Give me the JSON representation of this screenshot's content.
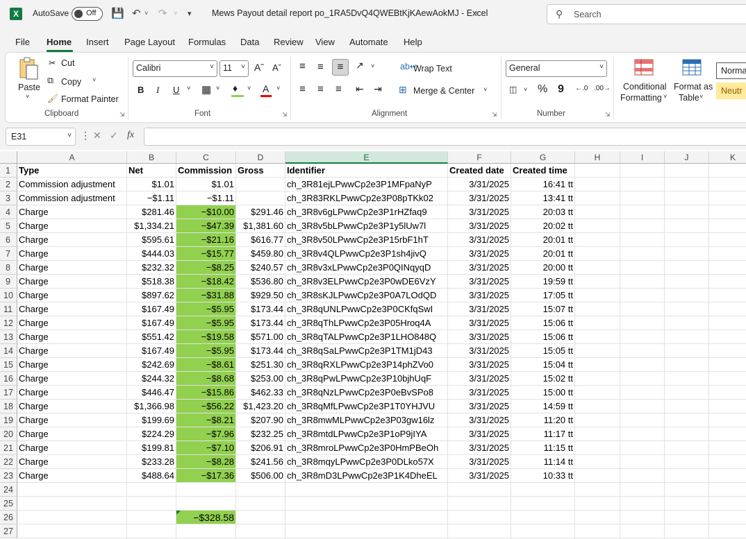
{
  "titlebar": {
    "app_icon": "excel-logo",
    "autosave_label": "AutoSave",
    "autosave_state": "Off",
    "document_title": "Mews Payout detail report po_1RA5DvQ4QWEBtKjKAewAokMJ  -  Excel",
    "search_placeholder": "Search"
  },
  "menu": {
    "tabs": [
      "File",
      "Home",
      "Insert",
      "Page Layout",
      "Formulas",
      "Data",
      "Review",
      "View",
      "Automate",
      "Help"
    ],
    "active": "Home"
  },
  "ribbon": {
    "clipboard": {
      "paste": "Paste",
      "cut": "Cut",
      "copy": "Copy",
      "format_painter": "Format Painter",
      "label": "Clipboard"
    },
    "font": {
      "family": "Calibri",
      "size": "11",
      "bold": "B",
      "italic": "I",
      "underline": "U",
      "label": "Font"
    },
    "alignment": {
      "wrap_text": "Wrap Text",
      "merge_center": "Merge & Center",
      "label": "Alignment"
    },
    "number": {
      "format": "General",
      "percent": "%",
      "comma": "9",
      "label": "Number"
    },
    "styles": {
      "conditional_formatting_1": "Conditional",
      "conditional_formatting_2": "Formatting",
      "format_as_table_1": "Format as",
      "format_as_table_2": "Table",
      "style_normal": "Norma",
      "style_neutral": "Neutr"
    }
  },
  "formula_bar": {
    "name_box": "E31",
    "fx": "fx",
    "content": ""
  },
  "sheet": {
    "selected_column": "E",
    "columns": [
      "A",
      "B",
      "C",
      "D",
      "E",
      "F",
      "G",
      "H",
      "I",
      "J",
      "K"
    ],
    "row_numbers": [
      "1",
      "2",
      "3",
      "4",
      "5",
      "6",
      "7",
      "8",
      "9",
      "10",
      "11",
      "12",
      "13",
      "14",
      "15",
      "16",
      "17",
      "18",
      "19",
      "20",
      "21",
      "22",
      "23",
      "24",
      "25",
      "26",
      "27"
    ],
    "headers": [
      "Type",
      "Net",
      "Commission",
      "Gross",
      "Identifier",
      "Created date",
      "Created time"
    ],
    "rows": [
      [
        "Commission adjustment",
        "$1.01",
        "$1.01",
        "",
        "ch_3R81ejLPwwCp2e3P1MFpaNyP",
        "3/31/2025",
        "16:41 tt"
      ],
      [
        "Commission adjustment",
        "−$1.11",
        "−$1.11",
        "",
        "ch_3R83RKLPwwCp2e3P08pTKk02",
        "3/31/2025",
        "13:41 tt"
      ],
      [
        "Charge",
        "$281.46",
        "−$10.00",
        "$291.46",
        "ch_3R8v6gLPwwCp2e3P1rHZfaq9",
        "3/31/2025",
        "20:03 tt"
      ],
      [
        "Charge",
        "$1,334.21",
        "−$47.39",
        "$1,381.60",
        "ch_3R8v5bLPwwCp2e3P1y5lUw7l",
        "3/31/2025",
        "20:02 tt"
      ],
      [
        "Charge",
        "$595.61",
        "−$21.16",
        "$616.77",
        "ch_3R8v50LPwwCp2e3P15rbF1hT",
        "3/31/2025",
        "20:01 tt"
      ],
      [
        "Charge",
        "$444.03",
        "−$15.77",
        "$459.80",
        "ch_3R8v4QLPwwCp2e3P1sh4jivQ",
        "3/31/2025",
        "20:01 tt"
      ],
      [
        "Charge",
        "$232.32",
        "−$8.25",
        "$240.57",
        "ch_3R8v3xLPwwCp2e3P0QINqyqD",
        "3/31/2025",
        "20:00 tt"
      ],
      [
        "Charge",
        "$518.38",
        "−$18.42",
        "$536.80",
        "ch_3R8v3ELPwwCp2e3P0wDE6VzY",
        "3/31/2025",
        "19:59 tt"
      ],
      [
        "Charge",
        "$897.62",
        "−$31.88",
        "$929.50",
        "ch_3R8sKJLPwwCp2e3P0A7LOdQD",
        "3/31/2025",
        "17:05 tt"
      ],
      [
        "Charge",
        "$167.49",
        "−$5.95",
        "$173.44",
        "ch_3R8qUNLPwwCp2e3P0CKfqSwI",
        "3/31/2025",
        "15:07 tt"
      ],
      [
        "Charge",
        "$167.49",
        "−$5.95",
        "$173.44",
        "ch_3R8qThLPwwCp2e3P05Hroq4A",
        "3/31/2025",
        "15:06 tt"
      ],
      [
        "Charge",
        "$551.42",
        "−$19.58",
        "$571.00",
        "ch_3R8qTALPwwCp2e3P1LHO848Q",
        "3/31/2025",
        "15:06 tt"
      ],
      [
        "Charge",
        "$167.49",
        "−$5.95",
        "$173.44",
        "ch_3R8qSaLPwwCp2e3P1TM1jD43",
        "3/31/2025",
        "15:05 tt"
      ],
      [
        "Charge",
        "$242.69",
        "−$8.61",
        "$251.30",
        "ch_3R8qRXLPwwCp2e3P14phZVo0",
        "3/31/2025",
        "15:04 tt"
      ],
      [
        "Charge",
        "$244.32",
        "−$8.68",
        "$253.00",
        "ch_3R8qPwLPwwCp2e3P10bjhUqF",
        "3/31/2025",
        "15:02 tt"
      ],
      [
        "Charge",
        "$446.47",
        "−$15.86",
        "$462.33",
        "ch_3R8qNzLPwwCp2e3P0eBvSPo8",
        "3/31/2025",
        "15:00 tt"
      ],
      [
        "Charge",
        "$1,366.98",
        "−$56.22",
        "$1,423.20",
        "ch_3R8qMfLPwwCp2e3P1T0YHJVU",
        "3/31/2025",
        "14:59 tt"
      ],
      [
        "Charge",
        "$199.69",
        "−$8.21",
        "$207.90",
        "ch_3R8mwMLPwwCp2e3P03gw16lz",
        "3/31/2025",
        "11:20 tt"
      ],
      [
        "Charge",
        "$224.29",
        "−$7.96",
        "$232.25",
        "ch_3R8mtdLPwwCp2e3P1oP9jIYA",
        "3/31/2025",
        "11:17 tt"
      ],
      [
        "Charge",
        "$199.81",
        "−$7.10",
        "$206.91",
        "ch_3R8mroLPwwCp2e3P0HmPBeOh",
        "3/31/2025",
        "11:15 tt"
      ],
      [
        "Charge",
        "$233.28",
        "−$8.28",
        "$241.56",
        "ch_3R8mqyLPwwCp2e3P0DLko57X",
        "3/31/2025",
        "11:14 tt"
      ],
      [
        "Charge",
        "$488.64",
        "−$17.36",
        "$506.00",
        "ch_3R8mD3LPwwCp2e3P1K4DheEL",
        "3/31/2025",
        "10:33 tt"
      ]
    ],
    "total_cell": "−$328.58",
    "fill_color": "#92d050",
    "accent": "#107c41"
  }
}
